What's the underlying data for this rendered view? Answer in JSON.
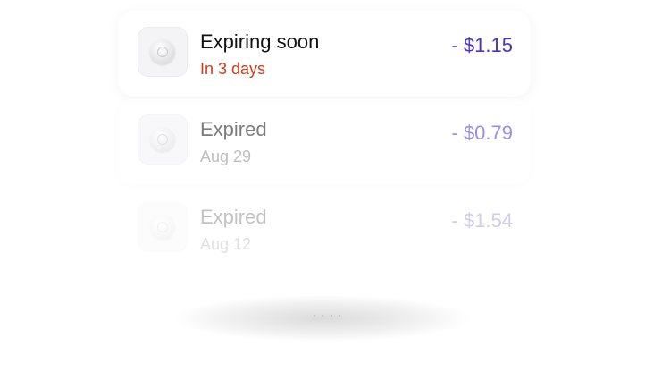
{
  "items": [
    {
      "title": "Expiring soon",
      "subtitle": "In 3 days",
      "amount": "- $1.15",
      "icon": "coin-icon"
    },
    {
      "title": "Expired",
      "subtitle": "Aug 29",
      "amount": "- $0.79",
      "icon": "coin-icon"
    },
    {
      "title": "Expired",
      "subtitle": "Aug 12",
      "amount": "- $1.54",
      "icon": "coin-icon"
    }
  ],
  "colors": {
    "amount": "#4a32c9",
    "urgent": "#d23a1e",
    "muted": "#8a8a8a"
  }
}
